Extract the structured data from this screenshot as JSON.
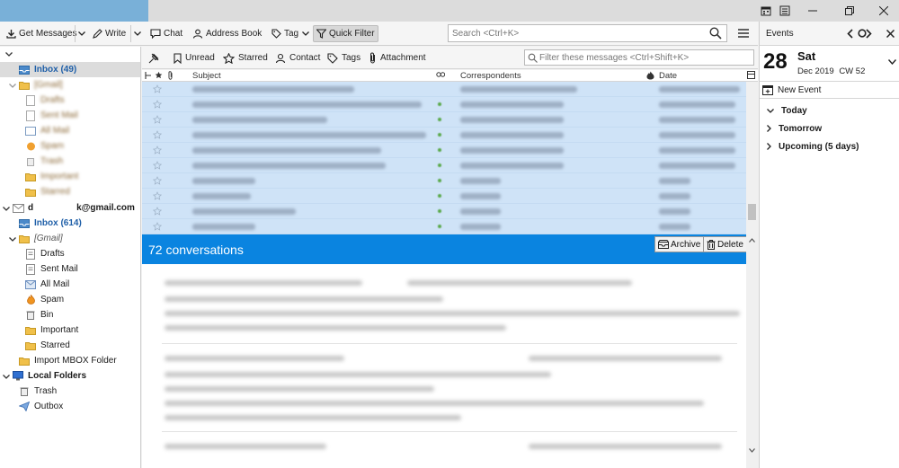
{
  "toolbar": {
    "get_messages": "Get Messages",
    "write": "Write",
    "chat": "Chat",
    "address_book": "Address Book",
    "tag": "Tag",
    "quick_filter": "Quick Filter",
    "search_placeholder": "Search <Ctrl+K>"
  },
  "folders": {
    "account1": {
      "inbox": "Inbox (49)",
      "gmail": "[Gmail]",
      "drafts": "Drafts",
      "sent": "Sent Mail",
      "all": "All Mail",
      "spam": "Spam",
      "trash": "Trash",
      "important": "Important",
      "starred": "Starred"
    },
    "account2": {
      "name_prefix": "d",
      "name_suffix": "k@gmail.com",
      "inbox": "Inbox (614)",
      "gmail": "[Gmail]",
      "drafts": "Drafts",
      "sent": "Sent Mail",
      "all": "All Mail",
      "spam": "Spam",
      "bin": "Bin",
      "important": "Important",
      "starred": "Starred"
    },
    "import_mbox": "Import MBOX Folder",
    "local_folders": "Local Folders",
    "local_trash": "Trash",
    "outbox": "Outbox"
  },
  "quick_filter_bar": {
    "unread": "Unread",
    "starred": "Starred",
    "contact": "Contact",
    "tags": "Tags",
    "attachment": "Attachment",
    "filter_placeholder": "Filter these messages <Ctrl+Shift+K>"
  },
  "columns": {
    "subject": "Subject",
    "correspondents": "Correspondents",
    "date": "Date"
  },
  "conversation": {
    "title": "72 conversations",
    "archive": "Archive",
    "delete": "Delete"
  },
  "events": {
    "header": "Events",
    "day_number": "28",
    "day_name": "Sat",
    "month_year": "Dec 2019",
    "week": "CW 52",
    "new_event": "New Event",
    "today": "Today",
    "tomorrow": "Tomorrow",
    "upcoming": "Upcoming (5 days)"
  },
  "colors": {
    "accent": "#0a84e0",
    "selection": "#cfe3f7",
    "inbox_blue": "#1f5fa8"
  }
}
